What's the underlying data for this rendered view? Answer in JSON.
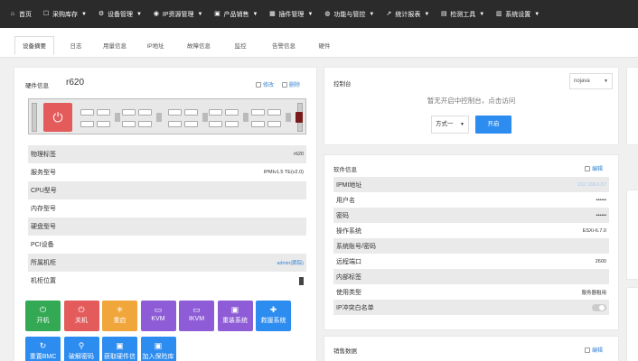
{
  "nav": [
    {
      "icon": "home-icon",
      "glyph": "⌂",
      "label": "首页",
      "caret": false
    },
    {
      "icon": "truck-icon",
      "glyph": "☐",
      "label": "采购库存",
      "caret": true
    },
    {
      "icon": "gear-icon",
      "glyph": "⚙",
      "label": "设备管理",
      "caret": true
    },
    {
      "icon": "pin-icon",
      "glyph": "◉",
      "label": "IP资源管理",
      "caret": true
    },
    {
      "icon": "cart-icon",
      "glyph": "▣",
      "label": "产品销售",
      "caret": true
    },
    {
      "icon": "puzzle-icon",
      "glyph": "▦",
      "label": "插件管理",
      "caret": true
    },
    {
      "icon": "shield-icon",
      "glyph": "◍",
      "label": "功能与管控",
      "caret": true
    },
    {
      "icon": "chart-icon",
      "glyph": "↗",
      "label": "统计报表",
      "caret": true
    },
    {
      "icon": "list-icon",
      "glyph": "▤",
      "label": "检测工具",
      "caret": true
    },
    {
      "icon": "grid-icon",
      "glyph": "▥",
      "label": "系统设置",
      "caret": true
    }
  ],
  "tabs": [
    "设备摘要",
    "日志",
    "用量信息",
    "IP地址",
    "故障信息",
    "监控",
    "告警信息",
    "硬件"
  ],
  "hardware": {
    "title": "硬件信息",
    "name": "r620",
    "edit": "修改",
    "delete": "删除",
    "rows": [
      {
        "k": "物理标签",
        "v": "r620"
      },
      {
        "k": "服务型号",
        "v": "IPMIv1.5 TE(v2.0)"
      },
      {
        "k": "CPU型号",
        "v": ""
      },
      {
        "k": "内存型号",
        "v": ""
      },
      {
        "k": "硬盘型号",
        "v": ""
      },
      {
        "k": "PCI设备",
        "v": ""
      },
      {
        "k": "所属机柜",
        "v": "admin(跟踪)"
      },
      {
        "k": "机柜位置",
        "v": ""
      }
    ]
  },
  "actions": [
    {
      "label": "开机",
      "color": "#33a954",
      "glyph": "⏻"
    },
    {
      "label": "关机",
      "color": "#e35b5b",
      "glyph": "⏻"
    },
    {
      "label": "重启",
      "color": "#f0a63a",
      "glyph": "✳"
    },
    {
      "label": "KVM",
      "color": "#8e5cd6",
      "glyph": "▭"
    },
    {
      "label": "IKVM",
      "color": "#8e5cd6",
      "glyph": "▭"
    },
    {
      "label": "重装系统",
      "color": "#8e5cd6",
      "glyph": "▣"
    },
    {
      "label": "救援系统",
      "color": "#2d8cf0",
      "glyph": "✚"
    },
    {
      "label": "重置BMC",
      "color": "#2d8cf0",
      "glyph": "↻"
    },
    {
      "label": "破解密码",
      "color": "#2d8cf0",
      "glyph": "⚲"
    },
    {
      "label": "获取硬件信息",
      "color": "#2d8cf0",
      "glyph": "▣"
    },
    {
      "label": "加入保险库",
      "color": "#2d8cf0",
      "glyph": "▣"
    }
  ],
  "console": {
    "title": "控制台",
    "dropdown": "nojava",
    "message": "暂无开启中控制台，点击访问",
    "mode": "方式一",
    "open": "开启"
  },
  "software": {
    "title": "软件信息",
    "edit": "编辑",
    "rows": [
      {
        "k": "IPMI地址",
        "v": "192.168.0.57"
      },
      {
        "k": "用户名",
        "v": "••••••"
      },
      {
        "k": "密码",
        "v": "••••••"
      },
      {
        "k": "操作系统",
        "v": "ESXi-6.7.0"
      },
      {
        "k": "系统账号/密码",
        "v": ""
      },
      {
        "k": "远程端口",
        "v": "2600"
      },
      {
        "k": "内部标签",
        "v": ""
      },
      {
        "k": "使用类型",
        "v": "服务器租用"
      },
      {
        "k": "IP冲突白名单",
        "v": ""
      }
    ]
  },
  "sales": {
    "title": "销售数据",
    "edit": "编辑"
  },
  "colors": {
    "accent": "#2d8cf0",
    "nav_bg": "#2b2b2b",
    "link": "#3a86d4"
  }
}
